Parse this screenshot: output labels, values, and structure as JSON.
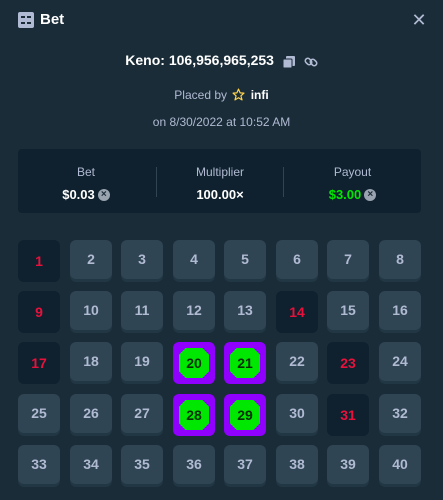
{
  "header": {
    "title": "Bet",
    "close_glyph": "✕"
  },
  "game": {
    "title": "Keno: 106,956,965,253",
    "placed_prefix": "Placed by",
    "user": "infi",
    "date": "on 8/30/2022 at 10:52 AM"
  },
  "summary": {
    "bet_label": "Bet",
    "bet_value": "$0.03",
    "multiplier_label": "Multiplier",
    "multiplier_value": "100.00×",
    "payout_label": "Payout",
    "payout_value": "$3.00"
  },
  "colors": {
    "hit": "#9000ff",
    "gem": "#00e701",
    "miss_text": "#e9113c",
    "payout": "#00e701"
  },
  "board": {
    "tiles": [
      {
        "n": "1",
        "s": "drawn"
      },
      {
        "n": "2",
        "s": "normal"
      },
      {
        "n": "3",
        "s": "normal"
      },
      {
        "n": "4",
        "s": "normal"
      },
      {
        "n": "5",
        "s": "normal"
      },
      {
        "n": "6",
        "s": "normal"
      },
      {
        "n": "7",
        "s": "normal"
      },
      {
        "n": "8",
        "s": "normal"
      },
      {
        "n": "9",
        "s": "drawn"
      },
      {
        "n": "10",
        "s": "normal"
      },
      {
        "n": "11",
        "s": "normal"
      },
      {
        "n": "12",
        "s": "normal"
      },
      {
        "n": "13",
        "s": "normal"
      },
      {
        "n": "14",
        "s": "drawn"
      },
      {
        "n": "15",
        "s": "normal"
      },
      {
        "n": "16",
        "s": "normal"
      },
      {
        "n": "17",
        "s": "drawn"
      },
      {
        "n": "18",
        "s": "normal"
      },
      {
        "n": "19",
        "s": "normal"
      },
      {
        "n": "20",
        "s": "hit"
      },
      {
        "n": "21",
        "s": "hit"
      },
      {
        "n": "22",
        "s": "normal"
      },
      {
        "n": "23",
        "s": "drawn"
      },
      {
        "n": "24",
        "s": "normal"
      },
      {
        "n": "25",
        "s": "normal"
      },
      {
        "n": "26",
        "s": "normal"
      },
      {
        "n": "27",
        "s": "normal"
      },
      {
        "n": "28",
        "s": "hit"
      },
      {
        "n": "29",
        "s": "hit"
      },
      {
        "n": "30",
        "s": "normal"
      },
      {
        "n": "31",
        "s": "drawn"
      },
      {
        "n": "32",
        "s": "normal"
      },
      {
        "n": "33",
        "s": "normal"
      },
      {
        "n": "34",
        "s": "normal"
      },
      {
        "n": "35",
        "s": "normal"
      },
      {
        "n": "36",
        "s": "normal"
      },
      {
        "n": "37",
        "s": "normal"
      },
      {
        "n": "38",
        "s": "normal"
      },
      {
        "n": "39",
        "s": "normal"
      },
      {
        "n": "40",
        "s": "normal"
      }
    ]
  }
}
